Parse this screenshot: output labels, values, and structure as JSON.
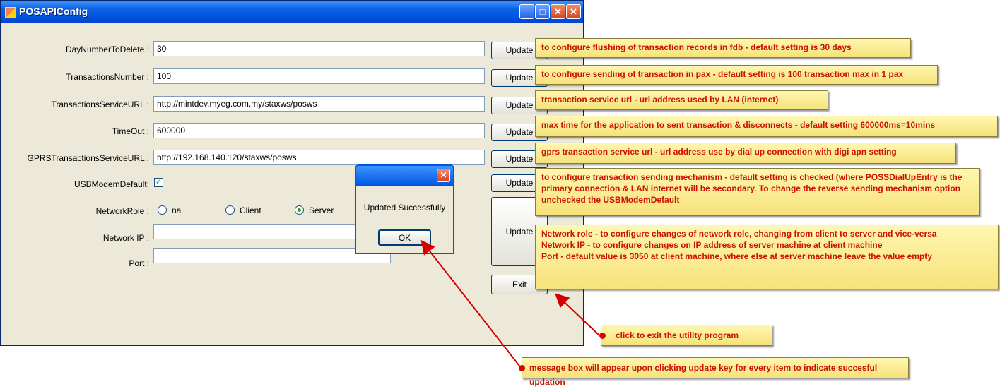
{
  "window": {
    "title": "POSAPIConfig",
    "buttons": {
      "minimize": "_",
      "maximize": "□",
      "close": "✕",
      "extra": "✕"
    }
  },
  "form": {
    "rows": [
      {
        "label": "DayNumberToDelete :",
        "value": "30",
        "button": "Update"
      },
      {
        "label": "TransactionsNumber :",
        "value": "100",
        "button": "Update"
      },
      {
        "label": "TransactionsServiceURL :",
        "value": "http://mintdev.myeg.com.my/staxws/posws",
        "button": "Update"
      },
      {
        "label": "TimeOut :",
        "value": "600000",
        "button": "Update"
      },
      {
        "label": "GPRSTransactionsServiceURL :",
        "value": "http://192.168.140.120/staxws/posws",
        "button": "Update"
      }
    ],
    "usb_label": "USBModemDefault:",
    "usb_checked": true,
    "usb_button": "Update",
    "network_role_label": "NetworkRole :",
    "network_role_options": [
      "na",
      "Client",
      "Server"
    ],
    "network_role_selected": "Server",
    "network_ip_label": "Network IP :",
    "network_ip_value": "",
    "port_label": "Port :",
    "port_value": "",
    "network_update_button": "Update",
    "exit_button": "Exit"
  },
  "message_box": {
    "text": "Updated Successfully",
    "ok_label": "OK",
    "close_icon": "✕"
  },
  "callouts": {
    "day_number": "to configure flushing of transaction records in fdb - default setting is 30 days",
    "transactions_number": "to configure sending of transaction in pax - default setting is 100 transaction max in 1 pax",
    "service_url": "transaction service url - url address used by LAN (internet)",
    "timeout": "max time for the application to sent transaction & disconnects - default setting 600000ms=10mins",
    "gprs_url": "gprs transaction service url - url address use by dial up connection with digi apn setting",
    "usb_modem": "to configure transaction sending mechanism - default setting is checked (where POSSDialUpEntry is the primary connection & LAN internet will be secondary. To change the reverse sending mechanism option unchecked the USBModemDefault",
    "network_1": "Network role - to configure changes of network role, changing from client to server and vice-versa",
    "network_2": "Network IP - to configure changes on IP address of server machine at client machine",
    "network_3": "Port - default value is 3050 at client machine, where else at server machine leave the value empty",
    "exit": "click to exit the utility program",
    "message_box": "message box will appear upon clicking update key for every item to indicate succesful updation"
  },
  "colors": {
    "callout_text": "#cc1100",
    "callout_bg": "#f6e27a",
    "arrow": "#d40000",
    "titlebar": "#0054e3"
  }
}
